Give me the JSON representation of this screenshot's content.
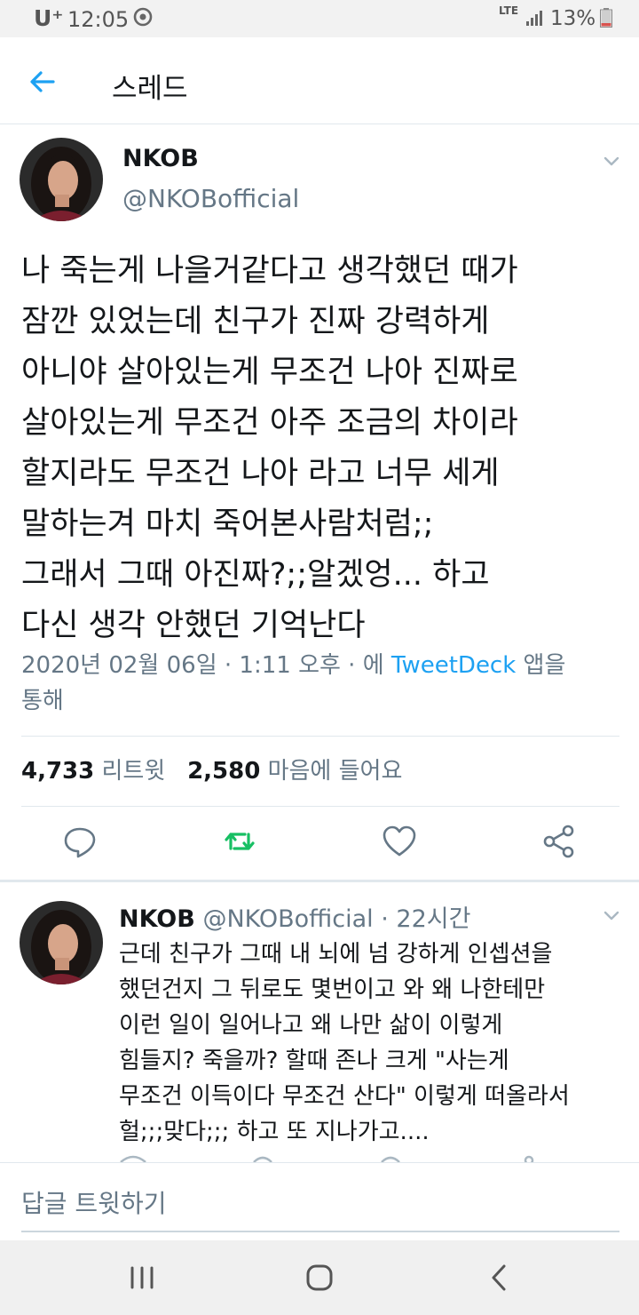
{
  "status_bar": {
    "carrier": "U⁺",
    "time": "12:05",
    "network": "LTE",
    "battery": "13%"
  },
  "header": {
    "title": "스레드"
  },
  "main_tweet": {
    "author_name": "NKOB",
    "author_handle": "@NKOBofficial",
    "text_lines": [
      "나 죽는게 나을거같다고 생각했던 때가",
      "잠깐 있었는데 친구가 진짜 강력하게",
      "아니야 살아있는게 무조건 나아 진짜로",
      "살아있는게 무조건 아주 조금의 차이라",
      "할지라도 무조건 나아 라고 너무 세게",
      "말하는겨 마치 죽어본사람처럼;;",
      "그래서 그때 아진짜?;;알겠엉... 하고",
      "다신 생각 안했던 기억난다"
    ],
    "timestamp_prefix": "2020년 02월 06일 · 1:11 오후 · 에 ",
    "source": "TweetDeck",
    "timestamp_suffix": " 앱을",
    "timestamp_line2": "통해",
    "retweets_count": "4,733",
    "retweets_label": "리트윗",
    "likes_count": "2,580",
    "likes_label": "마음에 들어요"
  },
  "reply_tweet": {
    "author_name": "NKOB",
    "author_handle": "@NKOBofficial",
    "age": "· 22시간",
    "text_lines": [
      "근데 친구가 그때 내 뇌에 넘 강하게 인셉션을",
      "했던건지 그 뒤로도 몇번이고 와 왜 나한테만",
      "이런 일이 일어나고 왜 나만 삶이 이렇게",
      "힘들지? 죽을까? 할때 존나 크게 \"사는게",
      "무조건 이득이다 무조건 산다\" 이렇게 떠올라서",
      "헐;;;맞다;;; 하고 또 지나가고...."
    ]
  },
  "reply_bar": {
    "placeholder": "답글 트윗하기"
  },
  "icons": {
    "back": "arrow-left-icon",
    "reply": "comment-icon",
    "retweet": "retweet-icon",
    "like": "heart-icon",
    "share": "share-icon",
    "caret": "chevron-down-icon"
  },
  "colors": {
    "accent": "#1da1f2",
    "retweet": "#17bf63",
    "secondary_text": "#657786",
    "primary_text": "#14171a"
  }
}
